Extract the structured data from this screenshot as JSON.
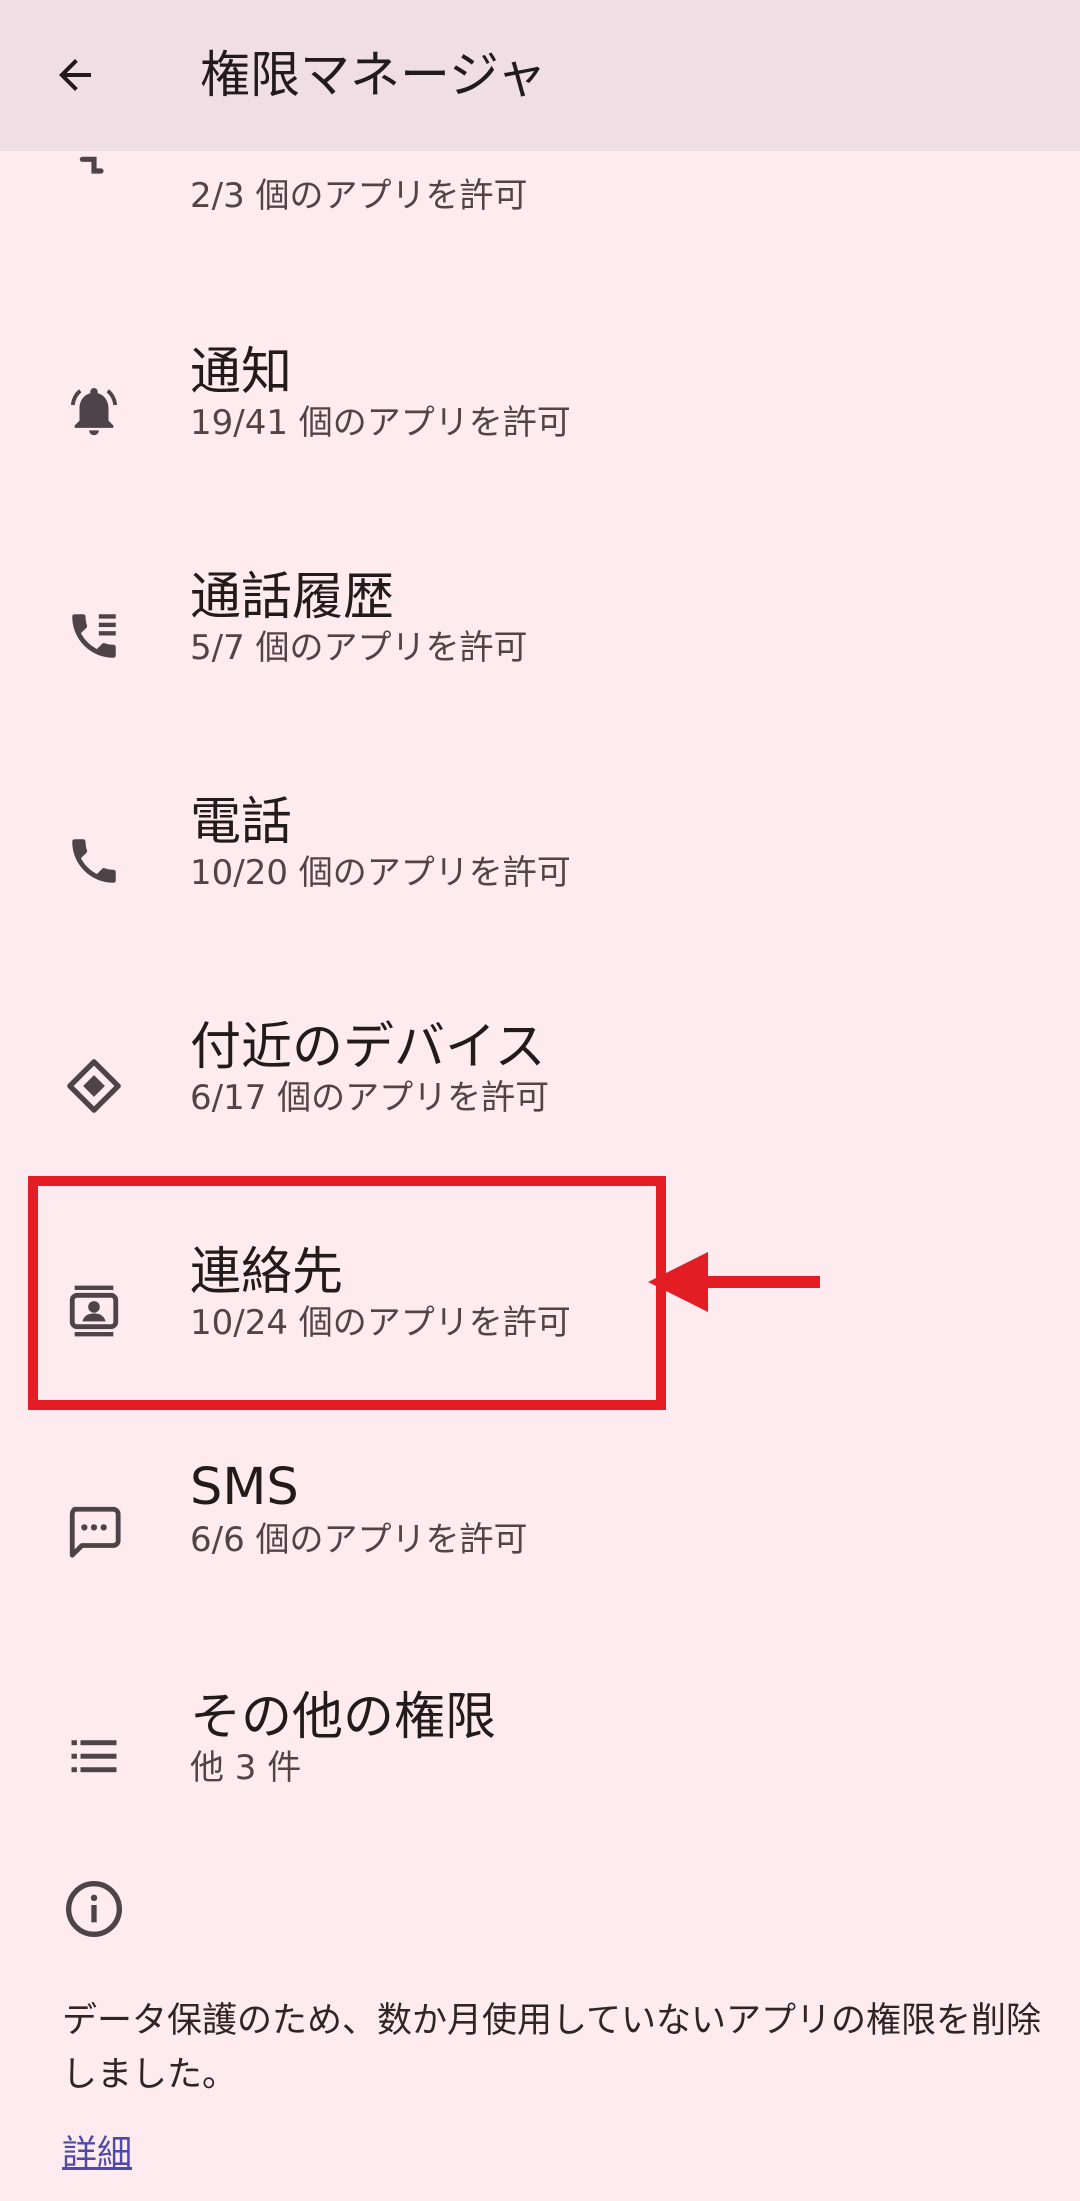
{
  "app_bar": {
    "title": "権限マネージャ",
    "back_icon": "arrow-back-icon"
  },
  "items": [
    {
      "title": "",
      "subtitle": "2/3 個のアプリを許可",
      "icon": "body-sensors-icon"
    },
    {
      "title": "通知",
      "subtitle": "19/41 個のアプリを許可",
      "icon": "bell-icon"
    },
    {
      "title": "通話履歴",
      "subtitle": "5/7 個のアプリを許可",
      "icon": "call-log-icon"
    },
    {
      "title": "電話",
      "subtitle": "10/20 個のアプリを許可",
      "icon": "phone-icon"
    },
    {
      "title": "付近のデバイス",
      "subtitle": "6/17 個のアプリを許可",
      "icon": "nearby-devices-icon"
    },
    {
      "title": "連絡先",
      "subtitle": "10/24 個のアプリを許可",
      "icon": "contacts-icon"
    },
    {
      "title": "SMS",
      "subtitle": "6/6 個のアプリを許可",
      "icon": "sms-icon"
    },
    {
      "title": "その他の権限",
      "subtitle": "他 3 件",
      "icon": "list-icon"
    }
  ],
  "footer": {
    "info_icon": "info-icon",
    "text": "データ保護のため、数か月使用していないアプリの権限を削除しました。",
    "link": "詳細"
  },
  "annotation": {
    "highlight_color": "#e21d24",
    "highlighted_item": "連絡先"
  },
  "colors": {
    "background": "#fdebf0",
    "app_bar": "#efdfe5",
    "text_primary": "#221a1d",
    "text_secondary": "#534349",
    "link": "#4f49a8",
    "icon": "#4e4348"
  }
}
